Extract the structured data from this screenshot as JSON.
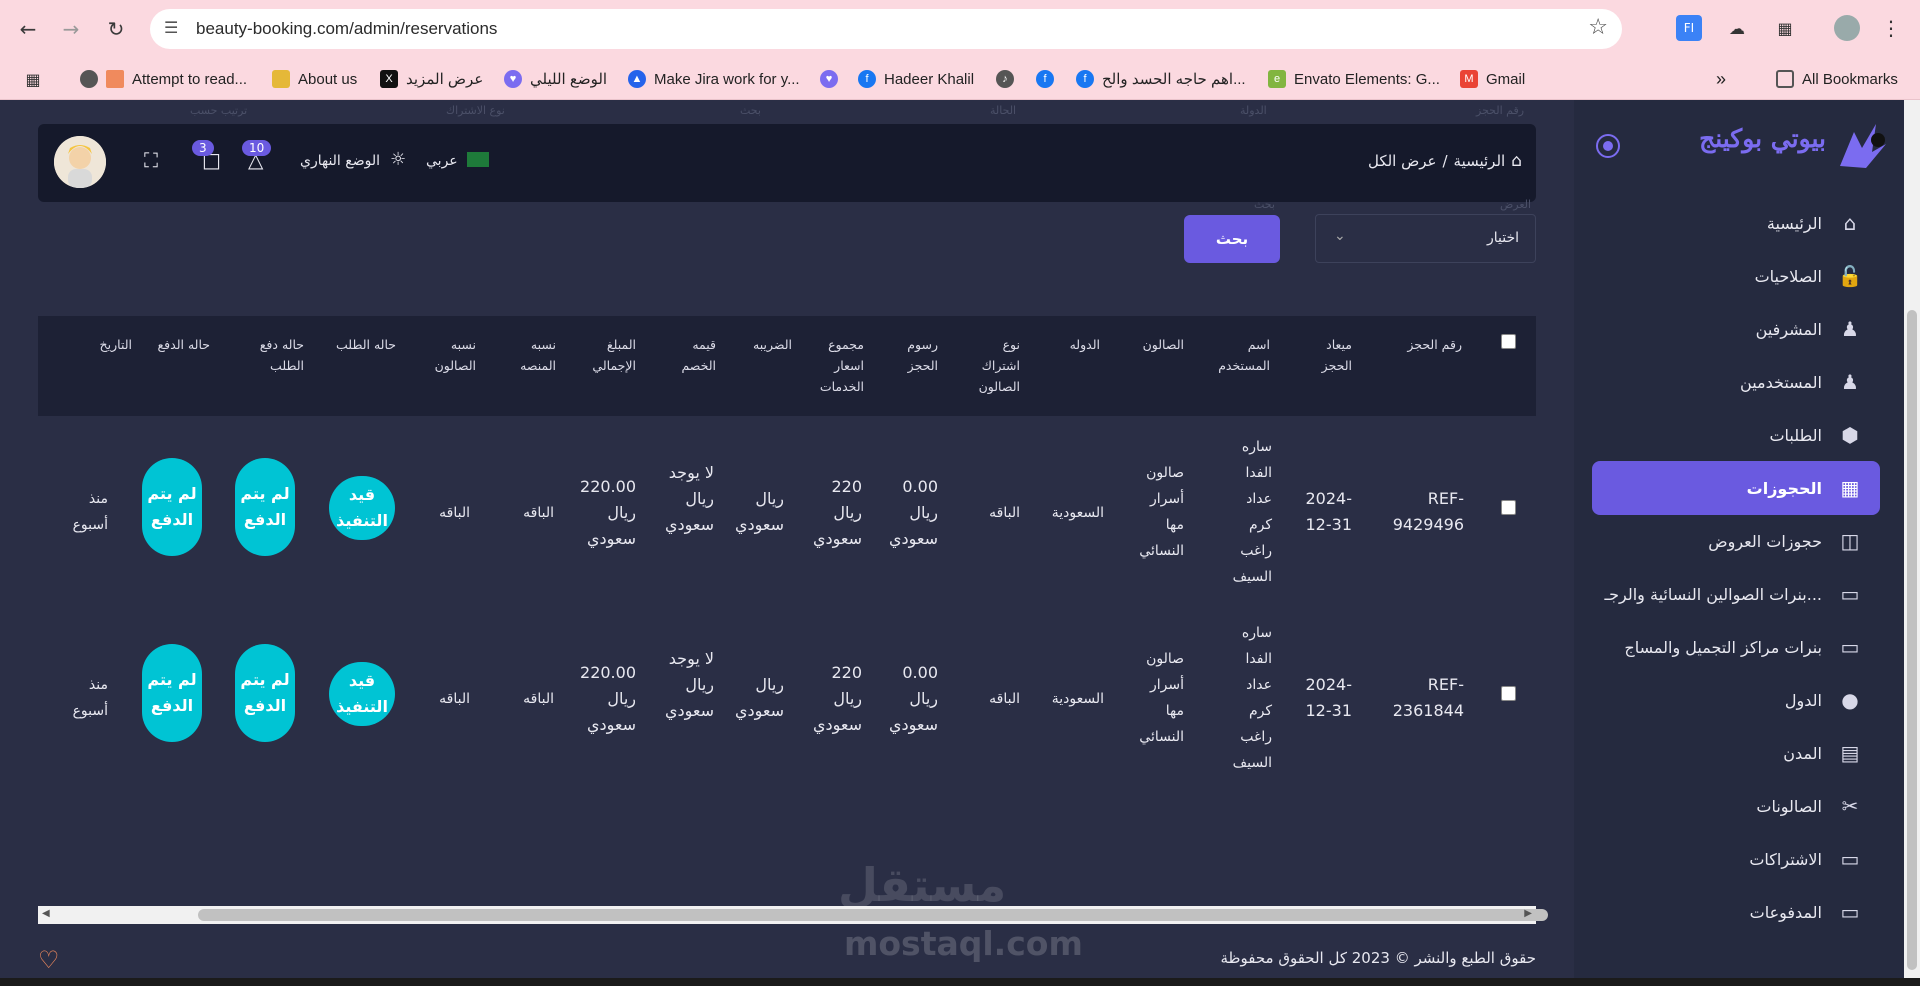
{
  "browser": {
    "url": "beauty-booking.com/admin/reservations",
    "bookmarks": [
      {
        "label": "Attempt to read...",
        "icon": "globe-icon"
      },
      {
        "label": "About us",
        "icon": "folder-icon"
      },
      {
        "label": "عرض المزيد",
        "icon": "x-icon"
      },
      {
        "label": "الوضع الليلي",
        "icon": "heart-icon"
      },
      {
        "label": "Make Jira work for y...",
        "icon": "atlassian-icon"
      },
      {
        "label": "Hadeer Khalil",
        "icon": "facebook-icon"
      },
      {
        "label": "اهم حاجه الحسد والح...",
        "icon": "facebook-icon"
      },
      {
        "label": "Envato Elements: G...",
        "icon": "envato-icon"
      },
      {
        "label": "Gmail",
        "icon": "gmail-icon"
      },
      {
        "label": "All Bookmarks",
        "icon": "folder-icon"
      }
    ]
  },
  "sidebar": {
    "brand": "بيوتي بوكينج",
    "items": [
      {
        "label": "الرئيسية",
        "icon": "home-icon"
      },
      {
        "label": "الصلاحيات",
        "icon": "lock-icon"
      },
      {
        "label": "المشرفين",
        "icon": "users-icon"
      },
      {
        "label": "المستخدمين",
        "icon": "user-group-icon"
      },
      {
        "label": "الطلبات",
        "icon": "box-icon"
      },
      {
        "label": "الحجوزات",
        "icon": "calendar-icon"
      },
      {
        "label": "حجوزات العروض",
        "icon": "archive-icon"
      },
      {
        "label": "بنرات الصوالين النسائية والرجـ...",
        "icon": "monitor-icon"
      },
      {
        "label": "بنرات مراكز التجميل والمساج",
        "icon": "monitor-icon"
      },
      {
        "label": "الدول",
        "icon": "globe-icon"
      },
      {
        "label": "المدن",
        "icon": "map-icon"
      },
      {
        "label": "الصالونات",
        "icon": "scissors-icon"
      },
      {
        "label": "الاشتراكات",
        "icon": "card-icon"
      },
      {
        "label": "المدفوعات",
        "icon": "card-icon"
      }
    ],
    "active_index": 5
  },
  "topbar": {
    "breadcrumb_home": "الرئيسية",
    "breadcrumb_sep": "/",
    "breadcrumb_current": "عرض الكل",
    "language": "عربي",
    "theme": "الوضع النهاري",
    "notifications_count": "10",
    "messages_count": "3"
  },
  "filters": {
    "select_label": "العرض",
    "select_value": "اختيار",
    "search_label": "بحث",
    "search_button": "بحث"
  },
  "table": {
    "headers": [
      "رقم الحجز",
      "ميعاد الحجز",
      "اسم المستخدم",
      "الصالون",
      "الدوله",
      "نوع اشتراك الصالون",
      "رسوم الحجز",
      "مجموع اسعار الخدمات",
      "الضريبه",
      "قيمه الخصم",
      "المبلغ الإجمالي",
      "نسبه المنصه",
      "نسبه الصالون",
      "حاله الطلب",
      "حاله دفع الطلب",
      "حاله الدفع",
      "التاريخ"
    ],
    "rows": [
      {
        "ref": "REF-9429496",
        "date": "2024-12-31",
        "user": "ساره الفدا عداد كرم راغب السيف",
        "salon": "صالون أسرار مها النسائي",
        "country": "السعودية",
        "subscription": "الباقه",
        "fee": "0.00 ريال سعودي",
        "services_total": "220 ريال سعودي",
        "tax": "ريال سعودي",
        "discount": "لا يوجد ريال سعودي",
        "total": "220.00 ريال سعودي",
        "platform_share": "الباقه",
        "salon_share": "الباقه",
        "order_status": "قيد التنفيذ",
        "order_payment_status": "لم يتم الدفع",
        "payment_status": "لم يتم الدفع",
        "created": "منذ أسبوع"
      },
      {
        "ref": "REF-2361844",
        "date": "2024-12-31",
        "user": "ساره الفدا عداد كرم راغب السيف",
        "salon": "صالون أسرار مها النسائي",
        "country": "السعودية",
        "subscription": "الباقه",
        "fee": "0.00 ريال سعودي",
        "services_total": "220 ريال سعودي",
        "tax": "ريال سعودي",
        "discount": "لا يوجد ريال سعودي",
        "total": "220.00 ريال سعودي",
        "platform_share": "الباقه",
        "salon_share": "الباقه",
        "order_status": "قيد التنفيذ",
        "order_payment_status": "لم يتم الدفع",
        "payment_status": "لم يتم الدفع",
        "created": "منذ أسبوع"
      }
    ]
  },
  "footer": {
    "copyright": "حقوق الطبع والنشر © 2023 كل الحقوق محفوظة"
  },
  "watermark": {
    "arabic": "مستقل",
    "latin": "mostaql.com"
  },
  "colors": {
    "accent": "#6a5ae0",
    "pill": "#00c4d4",
    "background": "#2a2e45",
    "topbar": "#15192b"
  }
}
